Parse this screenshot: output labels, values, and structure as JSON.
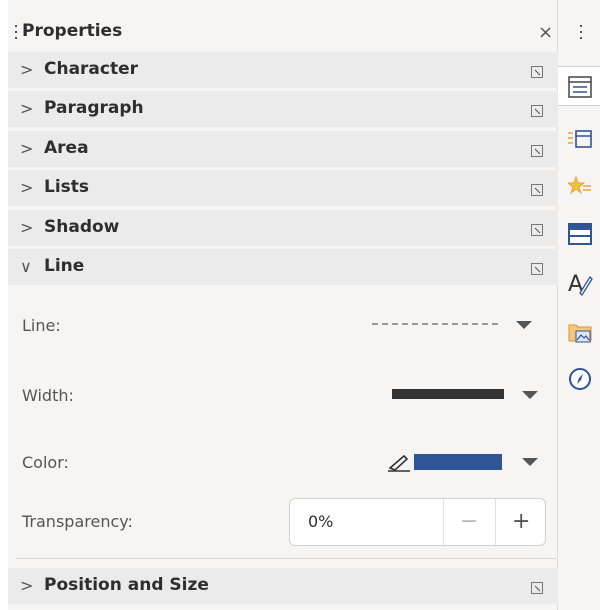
{
  "panel": {
    "title": "Properties",
    "close_glyph": "×"
  },
  "sections": [
    {
      "label": "Character",
      "expanded": false,
      "chevron": ">"
    },
    {
      "label": "Paragraph",
      "expanded": false,
      "chevron": ">"
    },
    {
      "label": "Area",
      "expanded": false,
      "chevron": ">"
    },
    {
      "label": "Lists",
      "expanded": false,
      "chevron": ">"
    },
    {
      "label": "Shadow",
      "expanded": false,
      "chevron": ">"
    },
    {
      "label": "Line",
      "expanded": true,
      "chevron": "∨"
    }
  ],
  "line_section": {
    "line_label": "Line:",
    "line_style": "dashed",
    "width_label": "Width:",
    "color_label": "Color:",
    "color_value": "#2f5597",
    "transparency_label": "Transparency:",
    "transparency_value": "0%",
    "minus_glyph": "−",
    "plus_glyph": "+"
  },
  "footer_section": {
    "label": "Position and Size",
    "expanded": false,
    "chevron": ">"
  },
  "tabbar": {
    "tabs": [
      {
        "icon": "properties-icon",
        "active": true
      },
      {
        "icon": "styles-icon",
        "active": false
      },
      {
        "icon": "gallery-icon",
        "active": false
      },
      {
        "icon": "navigator-icon",
        "active": false
      },
      {
        "icon": "fontwork-icon",
        "active": false
      },
      {
        "icon": "image-folder-icon",
        "active": false
      },
      {
        "icon": "compass-icon",
        "active": false
      }
    ]
  },
  "colors": {
    "accent": "#2f5597",
    "header_bg": "#ebebeb",
    "panel_bg": "#f6f5f4"
  }
}
